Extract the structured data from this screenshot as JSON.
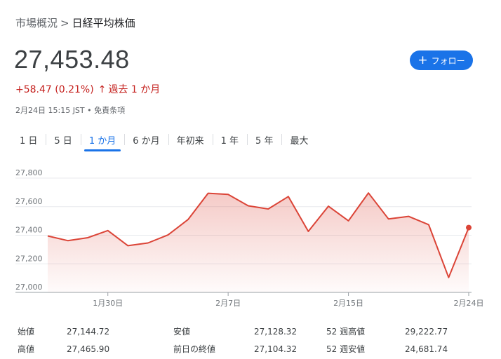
{
  "breadcrumb": {
    "parent": "市場概況",
    "separator": ">",
    "current": "日経平均株価"
  },
  "quote": {
    "price": "27,453.48",
    "change": "+58.47 (0.21%)",
    "arrow": "↑",
    "period": "過去 1 か月",
    "timestamp": "2月24日 15:15 JST • 免責条項"
  },
  "follow_button": {
    "icon": "+",
    "label": "フォロー"
  },
  "range_tabs": [
    "1 日",
    "5 日",
    "1 か月",
    "6 か月",
    "年初来",
    "1 年",
    "5 年",
    "最大"
  ],
  "active_tab": 2,
  "colors": {
    "line": "#db4437",
    "accent": "#1a73e8",
    "negative": "#c5221f"
  },
  "chart_data": {
    "type": "area",
    "x": [
      "1月25日",
      "1月26日",
      "1月27日",
      "1月30日",
      "1月31日",
      "2月1日",
      "2月2日",
      "2月3日",
      "2月6日",
      "2月7日",
      "2月8日",
      "2月9日",
      "2月10日",
      "2月13日",
      "2月14日",
      "2月15日",
      "2月16日",
      "2月17日",
      "2月20日",
      "2月21日",
      "2月22日",
      "2月24日"
    ],
    "values": [
      27395,
      27362,
      27383,
      27433,
      27327,
      27346,
      27402,
      27510,
      27694,
      27686,
      27606,
      27584,
      27671,
      27427,
      27603,
      27501,
      27696,
      27514,
      27532,
      27474,
      27104,
      27453.48
    ],
    "ylim": [
      27000,
      27800
    ],
    "yticks": [
      "27,800",
      "27,600",
      "27,400",
      "27,200",
      "27,000"
    ],
    "ytick_values": [
      27800,
      27600,
      27400,
      27200,
      27000
    ],
    "xticks": [
      {
        "label": "1月30日",
        "index": 3
      },
      {
        "label": "2月7日",
        "index": 9
      },
      {
        "label": "2月15日",
        "index": 15
      },
      {
        "label": "2月24日",
        "index": 21
      }
    ],
    "grid": true,
    "last_point_marker": true
  },
  "stats": [
    [
      {
        "label": "始値",
        "value": "27,144.72"
      },
      {
        "label": "安値",
        "value": "27,128.32"
      },
      {
        "label": "52 週高値",
        "value": "29,222.77"
      }
    ],
    [
      {
        "label": "高値",
        "value": "27,465.90"
      },
      {
        "label": "前日の終値",
        "value": "27,104.32"
      },
      {
        "label": "52 週安値",
        "value": "24,681.74"
      }
    ]
  ]
}
